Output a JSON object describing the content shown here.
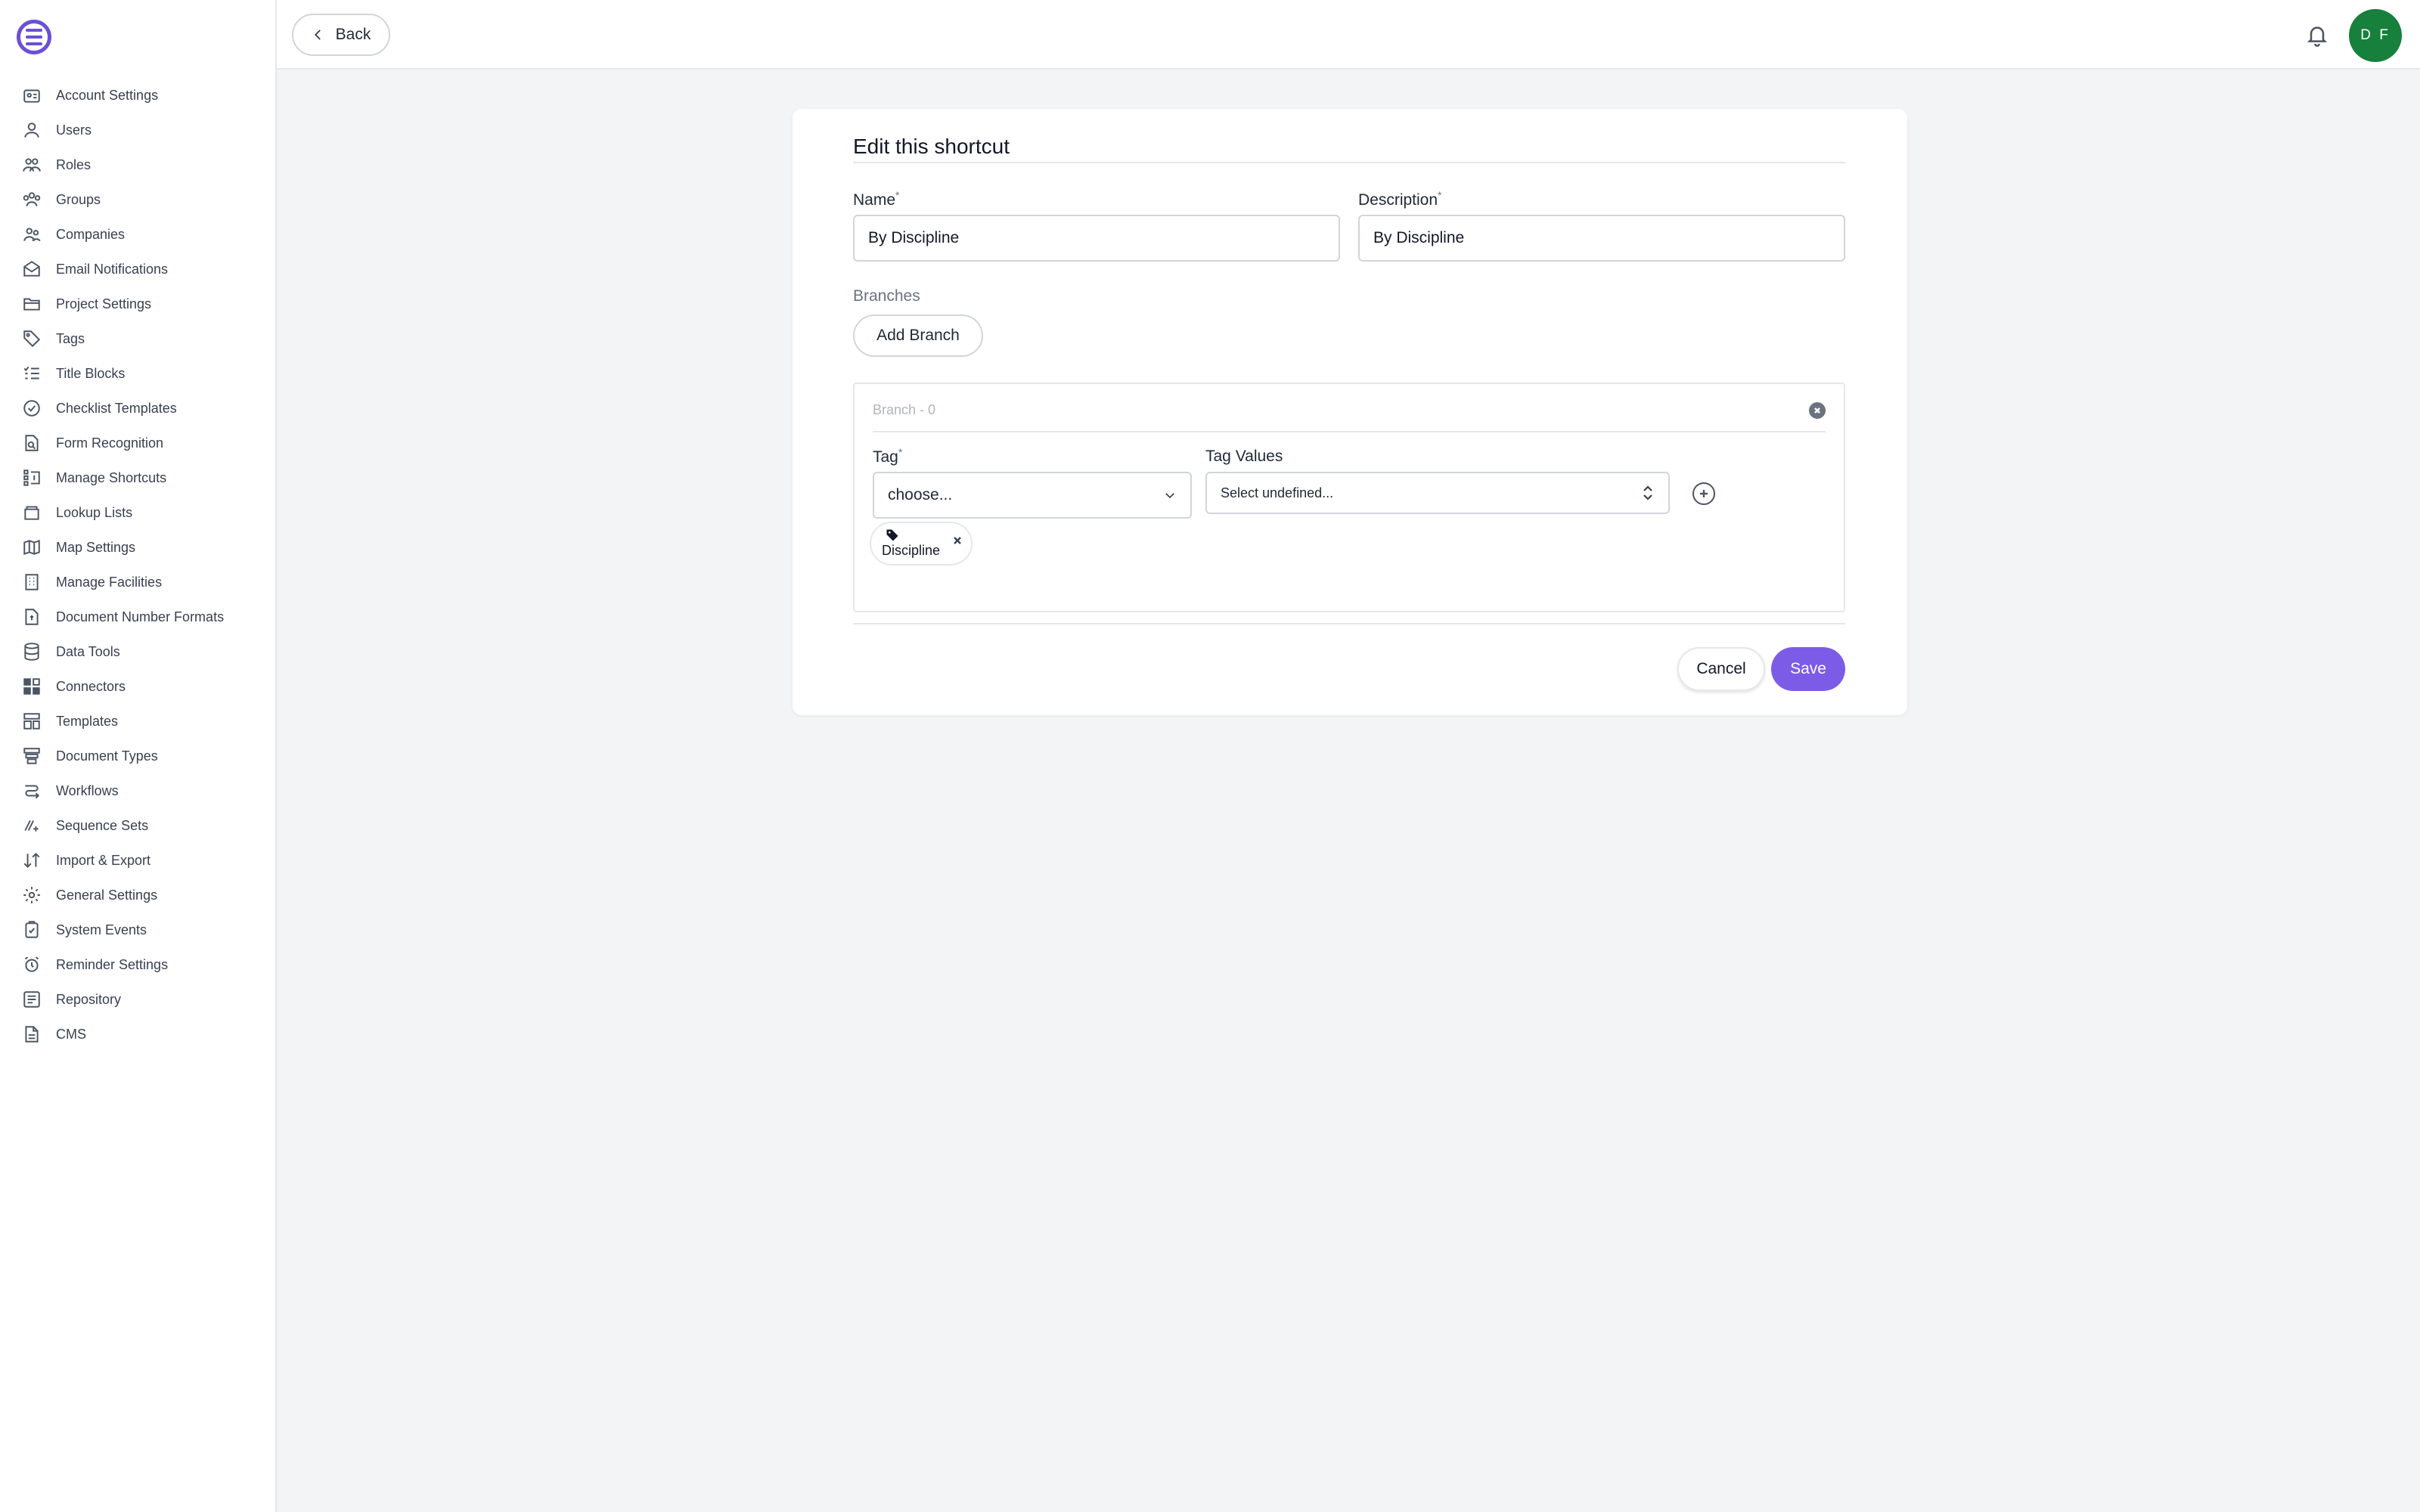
{
  "sidebar": {
    "items": [
      {
        "label": "Account Settings",
        "icon": "account-settings-icon"
      },
      {
        "label": "Users",
        "icon": "users-icon"
      },
      {
        "label": "Roles",
        "icon": "roles-icon"
      },
      {
        "label": "Groups",
        "icon": "groups-icon"
      },
      {
        "label": "Companies",
        "icon": "companies-icon"
      },
      {
        "label": "Email Notifications",
        "icon": "email-icon"
      },
      {
        "label": "Project Settings",
        "icon": "folder-icon"
      },
      {
        "label": "Tags",
        "icon": "tag-icon"
      },
      {
        "label": "Title Blocks",
        "icon": "list-icon"
      },
      {
        "label": "Checklist Templates",
        "icon": "check-circle-icon"
      },
      {
        "label": "Form Recognition",
        "icon": "document-search-icon"
      },
      {
        "label": "Manage Shortcuts",
        "icon": "shortcuts-icon"
      },
      {
        "label": "Lookup Lists",
        "icon": "lookup-icon"
      },
      {
        "label": "Map Settings",
        "icon": "map-icon"
      },
      {
        "label": "Manage Facilities",
        "icon": "building-icon"
      },
      {
        "label": "Document Number Formats",
        "icon": "document-number-icon"
      },
      {
        "label": "Data Tools",
        "icon": "database-icon"
      },
      {
        "label": "Connectors",
        "icon": "grid-icon"
      },
      {
        "label": "Templates",
        "icon": "templates-icon"
      },
      {
        "label": "Document Types",
        "icon": "document-types-icon"
      },
      {
        "label": "Workflows",
        "icon": "workflow-icon"
      },
      {
        "label": "Sequence Sets",
        "icon": "sequence-icon"
      },
      {
        "label": "Import & Export",
        "icon": "import-export-icon"
      },
      {
        "label": "General Settings",
        "icon": "gear-icon"
      },
      {
        "label": "System Events",
        "icon": "clipboard-check-icon"
      },
      {
        "label": "Reminder Settings",
        "icon": "alarm-icon"
      },
      {
        "label": "Repository",
        "icon": "repository-icon"
      },
      {
        "label": "CMS",
        "icon": "file-icon"
      }
    ]
  },
  "topbar": {
    "back_label": "Back",
    "avatar_initials": "D F"
  },
  "form": {
    "title": "Edit this shortcut",
    "name_label": "Name",
    "name_value": "By Discipline",
    "description_label": "Description",
    "description_value": "By Discipline",
    "required_mark": "*",
    "branches_label": "Branches",
    "add_branch_label": "Add Branch",
    "branch": {
      "name": "Branch - 0",
      "tag_label": "Tag",
      "tag_placeholder": "choose...",
      "tag_values_label": "Tag Values",
      "tag_values_placeholder": "Select undefined...",
      "chip_label": "Discipline"
    },
    "cancel_label": "Cancel",
    "save_label": "Save"
  },
  "colors": {
    "accent": "#7c5ce6",
    "avatar": "#16803c",
    "background": "#f3f4f6"
  }
}
